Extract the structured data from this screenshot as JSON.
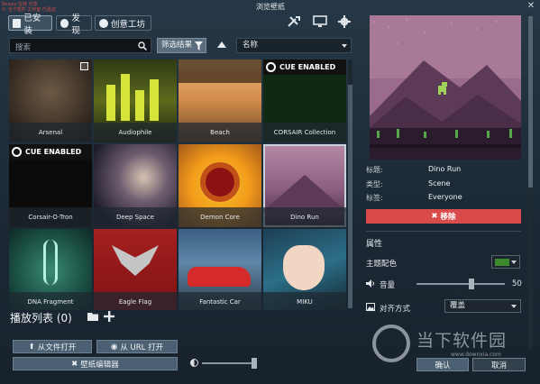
{
  "window": {
    "title": "浏览壁纸",
    "watermark_tl": "Snowy 在线 分享\n© 当下软件 工作室 已验证"
  },
  "tabs": [
    {
      "label": "已安装",
      "icon": "save-icon",
      "active": true
    },
    {
      "label": "发现",
      "icon": "compass-icon",
      "active": false
    },
    {
      "label": "创意工坊",
      "icon": "steam-icon",
      "active": false
    }
  ],
  "toolbar": {
    "search_placeholder": "搜索",
    "filter_label": "筛选结果",
    "sort_label": "名称"
  },
  "wallpapers": [
    {
      "name": "Arsenal",
      "kind": "arsenal"
    },
    {
      "name": "Audiophile",
      "kind": "audiophile"
    },
    {
      "name": "Beach",
      "kind": "beach"
    },
    {
      "name": "CORSAIR Collection",
      "kind": "corsair",
      "badge": "CUE ENABLED"
    },
    {
      "name": "Corsair-O-Tron",
      "kind": "corsairotron",
      "badge": "CUE ENABLED"
    },
    {
      "name": "Deep Space",
      "kind": "space"
    },
    {
      "name": "Demon Core",
      "kind": "demon"
    },
    {
      "name": "Dino Run",
      "kind": "dino",
      "selected": true
    },
    {
      "name": "DNA Fragment",
      "kind": "dna"
    },
    {
      "name": "Eagle Flag",
      "kind": "eagle"
    },
    {
      "name": "Fantastic Car",
      "kind": "car"
    },
    {
      "name": "MIKU",
      "kind": "miku"
    }
  ],
  "playlist": {
    "title": "播放列表 (0)",
    "open_file": "从文件打开",
    "open_url": "从 URL 打开",
    "editor": "壁纸编辑器",
    "brightness": 0.9
  },
  "details": {
    "title_label": "标题:",
    "title_value": "Dino Run",
    "type_label": "类型:",
    "type_value": "Scene",
    "tags_label": "标签:",
    "tags_value": "Everyone",
    "remove_label": "移除"
  },
  "properties": {
    "header": "属性",
    "color_label": "主题配色",
    "color_value": "#3c8a2d",
    "volume_label": "音量",
    "volume_value": "50",
    "align_label": "对齐方式",
    "align_value": "覆盖",
    "partial_label": "..."
  },
  "footer": {
    "ok": "确认",
    "cancel": "取消"
  },
  "watermark": {
    "text": "当下软件园",
    "url": "www.downxia.com"
  },
  "colors": {
    "accent": "#d94b4b",
    "button": "#4c6073"
  }
}
